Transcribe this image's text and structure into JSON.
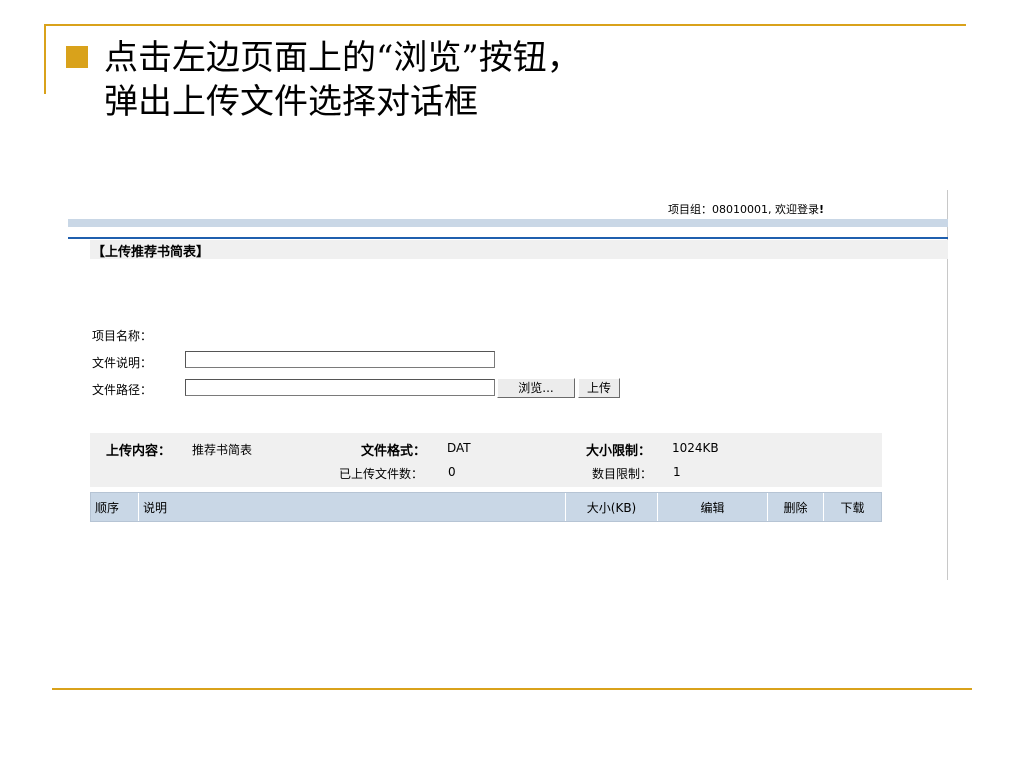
{
  "slide": {
    "line1": "点击左边页面上的“浏览”按钮，",
    "line2": "弹出上传文件选择对话框"
  },
  "page": {
    "welcome_text": "项目组：08010001, 欢迎登录",
    "welcome_mark": "!",
    "section_title": "【上传推荐书简表】",
    "form": {
      "project_name_label": "项目名称：",
      "file_desc_label": "文件说明：",
      "file_desc_value": "",
      "file_path_label": "文件路径：",
      "file_path_value": "",
      "browse_button": "浏览...",
      "upload_button": "上传"
    },
    "info": {
      "content_label": "上传内容：",
      "content_value": "推荐书简表",
      "format_label": "文件格式：",
      "format_value": "DAT",
      "size_limit_label": "大小限制：",
      "size_limit_value": "1024KB",
      "uploaded_count_label": "已上传文件数：",
      "uploaded_count_value": "0",
      "count_limit_label": "数目限制：",
      "count_limit_value": "1"
    },
    "table_headers": [
      "顺序",
      "说明",
      "大小(KB)",
      "编辑",
      "删除",
      "下载"
    ]
  },
  "colors": {
    "accent": "#D9A21B",
    "header_band": "#c9d7e6",
    "rule_blue": "#1f5fae"
  }
}
